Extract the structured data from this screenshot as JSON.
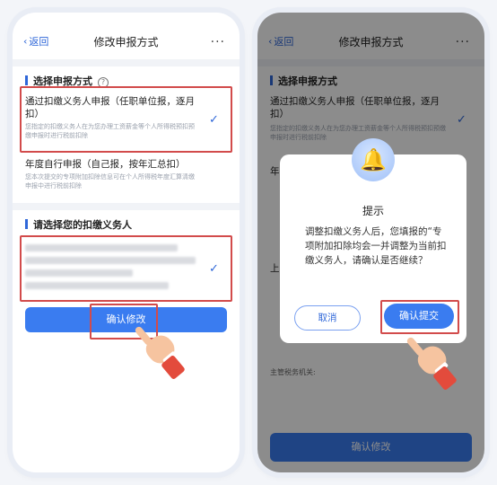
{
  "left": {
    "back_label": "返回",
    "page_title": "修改申报方式",
    "more": "...",
    "section1_title": "选择申报方式",
    "info_icon": "?",
    "option1_title": "通过扣缴义务人申报（任职单位报，逐月扣）",
    "option1_desc": "您指定的扣缴义务人在为您办理工资薪金等个人所得税预扣预缴申报时进行税前扣除",
    "option2_title": "年度自行申报（自己报，按年汇总扣）",
    "option2_desc": "您本次提交的专项附加扣除信息可在个人所得税年度汇算清缴申报中进行税前扣除",
    "section2_title": "请选择您的扣缴义务人",
    "confirm_button": "确认修改",
    "check": "✓"
  },
  "right": {
    "back_label": "返回",
    "page_title": "修改申报方式",
    "more": "...",
    "section1_title": "选择申报方式",
    "option1_title": "通过扣缴义务人申报（任职单位报，逐月扣）",
    "option1_desc": "您指定的扣缴义务人在为您办理工资薪金等个人所得税预扣预缴申报时进行税前扣除",
    "bg_year_char": "年",
    "bg_up_char": "上",
    "bg_tax_label": "主管税务机关:",
    "bottom_button": "确认修改",
    "modal": {
      "title": "提示",
      "body": "调整扣缴义务人后，您填报的“专项附加扣除均会一并调整为当前扣缴义务人，请确认是否继续？",
      "cancel": "取消",
      "confirm": "确认提交"
    },
    "check": "✓"
  },
  "colors": {
    "accent": "#3a7cf0",
    "highlight": "#d24b4b"
  },
  "icons": [
    "chevron-left-icon",
    "more-icon",
    "info-icon",
    "check-icon",
    "bell-icon",
    "hand-pointer-icon"
  ]
}
